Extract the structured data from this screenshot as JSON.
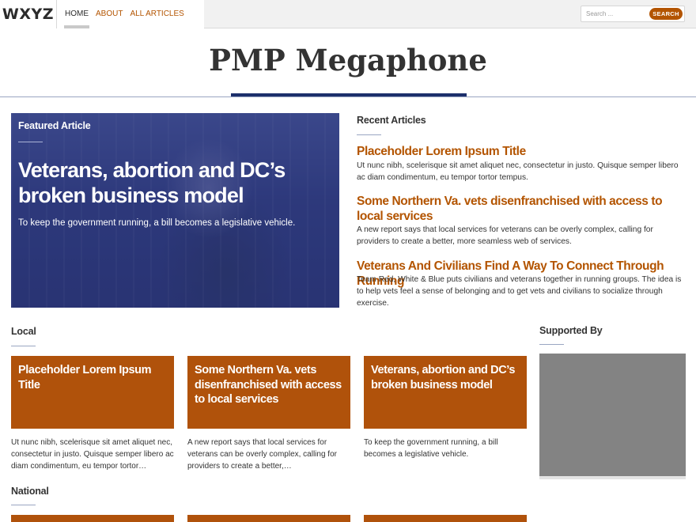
{
  "brand": {
    "logo": "WXYZ"
  },
  "nav": {
    "home": "HOME",
    "about": "ABOUT",
    "all_articles": "ALL ARTICLES"
  },
  "search": {
    "placeholder": "Search ...",
    "button": "SEARCH"
  },
  "site_title": "PMP Megaphone",
  "featured": {
    "label": "Featured Article",
    "headline": "Veterans, abortion and DC’s broken business model",
    "dek": "To keep the government running, a bill becomes a legislative vehicle."
  },
  "recent": {
    "label": "Recent Articles",
    "items": [
      {
        "title": "Placeholder Lorem Ipsum Title",
        "body": "Ut nunc nibh, scelerisque sit amet aliquet nec, consectetur in justo. Quisque semper libero ac diam condimentum, eu tempor tortor tempus."
      },
      {
        "title": "Some Northern Va. vets disenfranchised with access to local services",
        "body": "A new report says that local services for veterans can be overly complex, calling for providers to create a better, more seamless web of services."
      },
      {
        "title": "Veterans And Civilians Find A Way To Connect Through Running",
        "body": "Team Red, White & Blue puts civilians and veterans together in running groups. The idea is to help vets feel a sense of belonging and to get vets and civilians to socialize through exercise."
      }
    ]
  },
  "local": {
    "label": "Local",
    "cards": [
      {
        "title": "Placeholder Lorem Ipsum Title",
        "excerpt": "Ut nunc nibh, scelerisque sit amet aliquet nec, consectetur in justo. Quisque semper libero ac diam condimentum, eu tempor tortor…"
      },
      {
        "title": "Some Northern Va. vets disenfranchised with access to local services",
        "excerpt": "A new report says that local services for veterans can be overly complex, calling for providers to create a better,…"
      },
      {
        "title": "Veterans, abortion and DC’s broken business model",
        "excerpt": "To keep the government running, a bill becomes a legislative vehicle."
      }
    ]
  },
  "supported_by": {
    "label": "Supported By"
  },
  "national": {
    "label": "National"
  },
  "colors": {
    "accent": "#b35400",
    "card": "#b0520b",
    "navy": "#1c2f6b",
    "sponsor_placeholder": "#838383"
  }
}
